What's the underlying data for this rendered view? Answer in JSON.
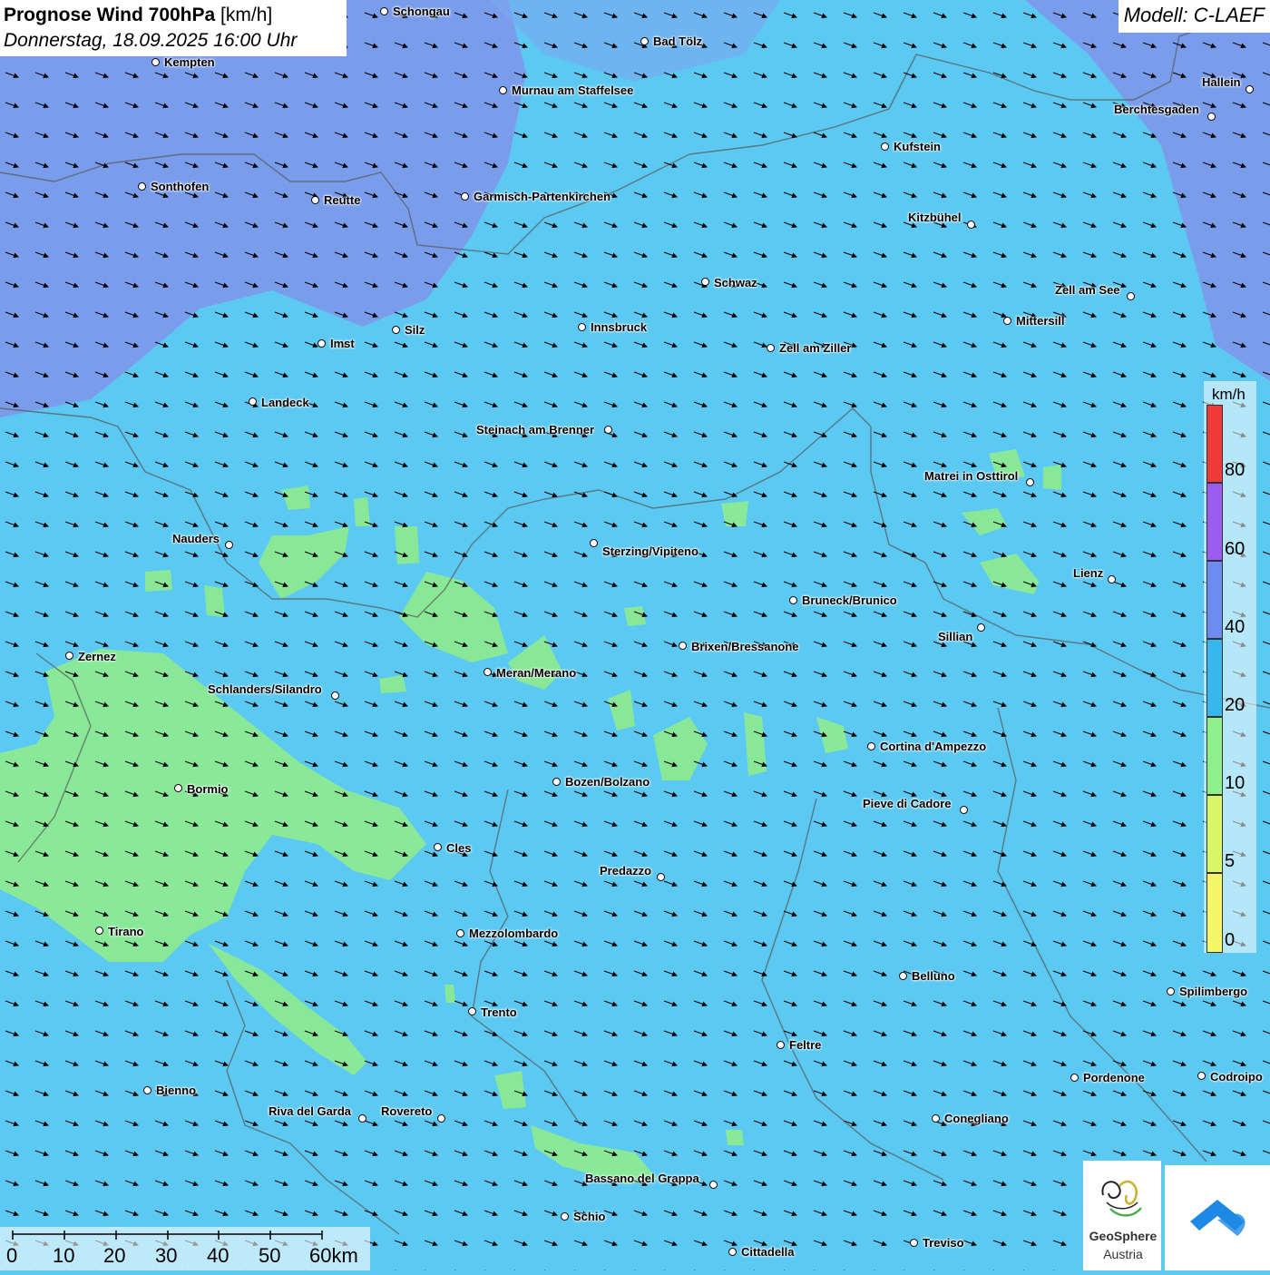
{
  "title": {
    "main": "Prognose Wind 700hPa",
    "unit": "[km/h]",
    "datetime": "Donnerstag, 18.09.2025 16:00 Uhr"
  },
  "model": "Modell: C-LAEF",
  "legend": {
    "unit": "km/h",
    "ticks": [
      "80",
      "60",
      "40",
      "20",
      "10",
      "5",
      "0"
    ],
    "colors": [
      "#f03a3a",
      "#9b5cf0",
      "#6c8cf2",
      "#36b8ef",
      "#8ef08a",
      "#d9f568",
      "#f5f56a"
    ]
  },
  "scale": {
    "labels": [
      "0",
      "10",
      "20",
      "30",
      "40",
      "50",
      "60km"
    ]
  },
  "logos": {
    "geosphere_line1": "GeoSphere",
    "geosphere_line2": "Austria"
  },
  "cities": [
    "Schongau",
    "Bad Tölz",
    "Kempten",
    "Murnau am Staffelsee",
    "Hallein",
    "Berchtesgaden",
    "Kufstein",
    "Sonthofen",
    "Reutte",
    "Garmisch-Partenkirchen",
    "Kitzbühel",
    "Schwaz",
    "Zell am See",
    "Innsbruck",
    "Mittersill",
    "Silz",
    "Imst",
    "Zell am Ziller",
    "Landeck",
    "Steinach am Brenner",
    "Matrei in Osttirol",
    "Nauders",
    "Sterzing/Vipiteno",
    "Lienz",
    "Bruneck/Brunico",
    "Sillian",
    "Zernez",
    "Brixen/Bressanone",
    "Meran/Merano",
    "Schlanders/Silandro",
    "Cortina d'Ampezzo",
    "Bozen/Bolzano",
    "Bormio",
    "Pieve di Cadore",
    "Cles",
    "Predazzo",
    "Tirano",
    "Mezzolombardo",
    "Belluno",
    "Spilimbergo",
    "Trento",
    "Feltre",
    "Pordenone",
    "Codroipo",
    "Bienno",
    "Riva del Garda",
    "Rovereto",
    "Conegliano",
    "Bassano del Grappa",
    "Schio",
    "Treviso",
    "Cittadella"
  ]
}
